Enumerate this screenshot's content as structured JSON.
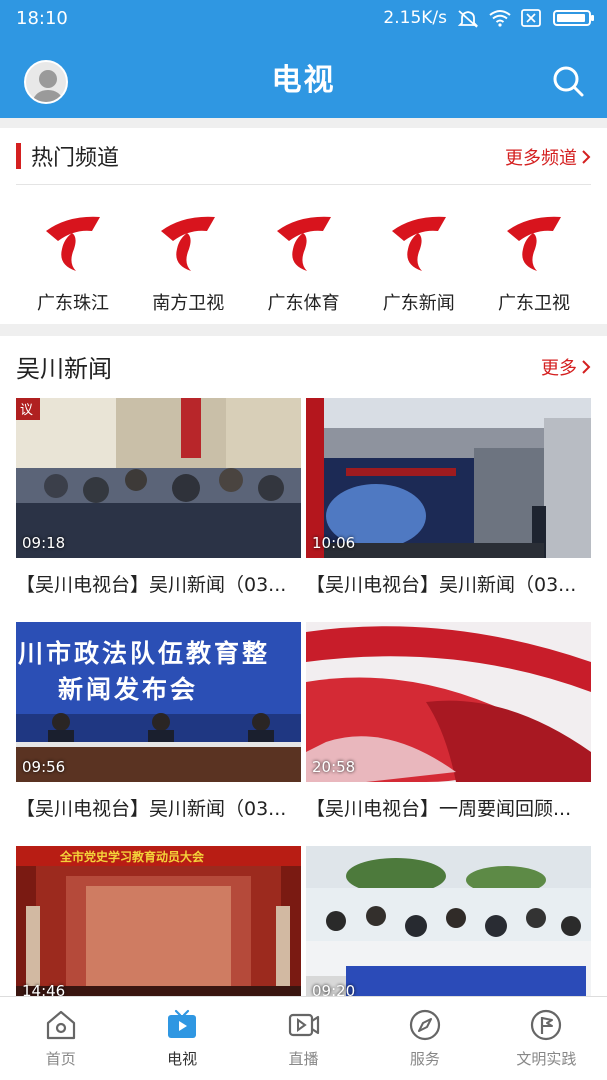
{
  "status_bar": {
    "time": "18:10",
    "network_speed": "2.15K/s"
  },
  "header": {
    "title": "电视",
    "avatar_icon": "avatar-icon",
    "search_icon": "search-icon"
  },
  "hot_channels": {
    "title": "热门频道",
    "more": "更多频道",
    "channels": [
      {
        "label": "广东珠江"
      },
      {
        "label": "南方卫视"
      },
      {
        "label": "广东体育"
      },
      {
        "label": "广东新闻"
      },
      {
        "label": "广东卫视"
      }
    ]
  },
  "news": {
    "title": "吴川新闻",
    "more": "更多",
    "items": [
      {
        "duration": "09:18",
        "caption": "【吴川电视台】吴川新闻（03..."
      },
      {
        "duration": "10:06",
        "caption": "【吴川电视台】吴川新闻（03..."
      },
      {
        "duration": "09:56",
        "caption": "【吴川电视台】吴川新闻（03..."
      },
      {
        "duration": "20:58",
        "caption": "【吴川电视台】一周要闻回顾..."
      },
      {
        "duration": "14:46",
        "caption": ""
      },
      {
        "duration": "09:20",
        "caption": ""
      }
    ],
    "thumb_texts": {
      "item1_banner": "议",
      "item3_line1": "川市政法队伍教育整",
      "item3_line2": "新闻发布会",
      "item5_banner": "全市党史学习教育动员大会"
    }
  },
  "bottom_nav": {
    "tabs": [
      {
        "label": "首页",
        "icon": "home-icon"
      },
      {
        "label": "电视",
        "icon": "tv-icon",
        "active": true
      },
      {
        "label": "直播",
        "icon": "live-icon"
      },
      {
        "label": "服务",
        "icon": "compass-icon"
      },
      {
        "label": "文明实践",
        "icon": "flag-icon"
      }
    ]
  },
  "colors": {
    "primary": "#2f97e2",
    "accent": "#d42020"
  }
}
